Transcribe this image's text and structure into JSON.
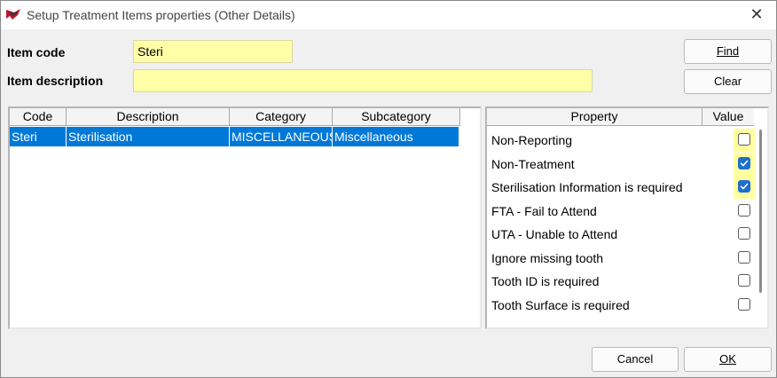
{
  "window": {
    "title": "Setup Treatment Items properties (Other Details)",
    "close_glyph": "✕"
  },
  "form": {
    "item_code_label": "Item code",
    "item_code_value": "Steri",
    "item_description_label": "Item description",
    "item_description_value": ""
  },
  "buttons": {
    "find": "Find",
    "clear": "Clear",
    "cancel": "Cancel",
    "ok": "OK"
  },
  "items_grid": {
    "columns": [
      "Code",
      "Description",
      "Category",
      "Subcategory"
    ],
    "rows": [
      {
        "code": "Steri",
        "description": "Sterilisation",
        "category": "MISCELLANEOUS",
        "subcategory": "Miscellaneous",
        "selected": true
      }
    ]
  },
  "properties_grid": {
    "columns": [
      "Property",
      "Value"
    ],
    "rows": [
      {
        "name": "Non-Reporting",
        "checked": false,
        "highlighted": true
      },
      {
        "name": "Non-Treatment",
        "checked": true,
        "highlighted": true
      },
      {
        "name": "Sterilisation Information is required",
        "checked": true,
        "highlighted": true
      },
      {
        "name": "FTA - Fail to Attend",
        "checked": false,
        "highlighted": false
      },
      {
        "name": "UTA - Unable to Attend",
        "checked": false,
        "highlighted": false
      },
      {
        "name": "Ignore missing tooth",
        "checked": false,
        "highlighted": false
      },
      {
        "name": "Tooth ID is required",
        "checked": false,
        "highlighted": false
      },
      {
        "name": "Tooth Surface is required",
        "checked": false,
        "highlighted": false
      }
    ]
  },
  "colors": {
    "field_yellow": "#ffffa8",
    "selection_blue": "#0078d7",
    "checkbox_blue": "#1d6fd0"
  },
  "icons": {
    "app": "app-logo-icon",
    "close": "close-icon",
    "check": "checkmark-icon"
  }
}
